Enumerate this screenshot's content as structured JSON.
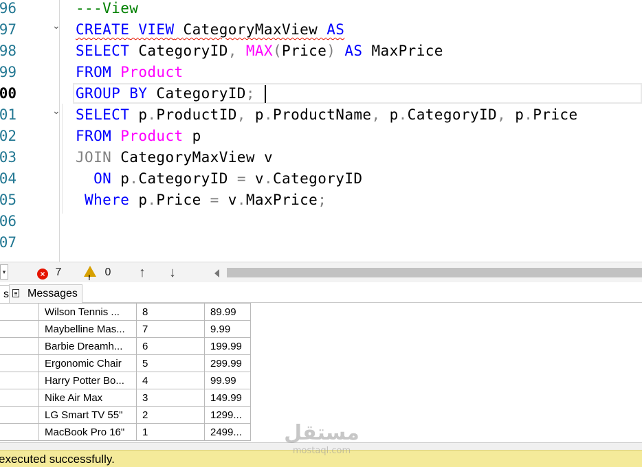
{
  "editor": {
    "line_numbers": [
      "96",
      "97",
      "98",
      "99",
      "00",
      "01",
      "02",
      "03",
      "04",
      "05",
      "06",
      "07"
    ],
    "current_line": "00",
    "lines": [
      [
        [
          "cm",
          "---View"
        ]
      ],
      [
        [
          "kw sq",
          "CREATE"
        ],
        [
          "sp sq",
          " "
        ],
        [
          "kw sq",
          "VIEW"
        ],
        [
          "sp sq",
          " "
        ],
        [
          "id sq",
          "CategoryMaxView"
        ],
        [
          "sp sq",
          " "
        ],
        [
          "kw sq",
          "AS"
        ]
      ],
      [
        [
          "kw",
          "SELECT"
        ],
        [
          "sp",
          " "
        ],
        [
          "id",
          "CategoryID"
        ],
        [
          "pu",
          ","
        ],
        [
          "sp",
          " "
        ],
        [
          "fn",
          "MAX"
        ],
        [
          "pu",
          "("
        ],
        [
          "id",
          "Price"
        ],
        [
          "pu",
          ")"
        ],
        [
          "sp",
          " "
        ],
        [
          "kw",
          "AS"
        ],
        [
          "sp",
          " "
        ],
        [
          "id",
          "MaxPrice"
        ]
      ],
      [
        [
          "kw",
          "FROM"
        ],
        [
          "sp",
          " "
        ],
        [
          "fn",
          "Product"
        ]
      ],
      [
        [
          "kw",
          "GROUP"
        ],
        [
          "sp",
          " "
        ],
        [
          "kw",
          "BY"
        ],
        [
          "sp",
          " "
        ],
        [
          "id",
          "CategoryID"
        ],
        [
          "pu",
          ";"
        ]
      ],
      [
        [
          "kw",
          "SELECT"
        ],
        [
          "sp",
          " "
        ],
        [
          "id",
          "p"
        ],
        [
          "pu",
          "."
        ],
        [
          "id",
          "ProductID"
        ],
        [
          "pu",
          ","
        ],
        [
          "sp",
          " "
        ],
        [
          "id",
          "p"
        ],
        [
          "pu",
          "."
        ],
        [
          "id",
          "ProductName"
        ],
        [
          "pu",
          ","
        ],
        [
          "sp",
          " "
        ],
        [
          "id",
          "p"
        ],
        [
          "pu",
          "."
        ],
        [
          "id",
          "CategoryID"
        ],
        [
          "pu",
          ","
        ],
        [
          "sp",
          " "
        ],
        [
          "id",
          "p"
        ],
        [
          "pu",
          "."
        ],
        [
          "id",
          "Price"
        ]
      ],
      [
        [
          "kw",
          "FROM"
        ],
        [
          "sp",
          " "
        ],
        [
          "fn",
          "Product"
        ],
        [
          "sp",
          " "
        ],
        [
          "id",
          "p"
        ]
      ],
      [
        [
          "gr",
          "JOIN"
        ],
        [
          "sp",
          " "
        ],
        [
          "id",
          "CategoryMaxView"
        ],
        [
          "sp",
          " "
        ],
        [
          "id",
          "v"
        ]
      ],
      [
        [
          "sp",
          "  "
        ],
        [
          "kw",
          "ON"
        ],
        [
          "sp",
          " "
        ],
        [
          "id",
          "p"
        ],
        [
          "pu",
          "."
        ],
        [
          "id",
          "CategoryID"
        ],
        [
          "sp",
          " "
        ],
        [
          "pu",
          "="
        ],
        [
          "sp",
          " "
        ],
        [
          "id",
          "v"
        ],
        [
          "pu",
          "."
        ],
        [
          "id",
          "CategoryID"
        ]
      ],
      [
        [
          "sp",
          " "
        ],
        [
          "kw",
          "Where"
        ],
        [
          "sp",
          " "
        ],
        [
          "id",
          "p"
        ],
        [
          "pu",
          "."
        ],
        [
          "id",
          "Price"
        ],
        [
          "sp",
          " "
        ],
        [
          "pu",
          "="
        ],
        [
          "sp",
          " "
        ],
        [
          "id",
          "v"
        ],
        [
          "pu",
          "."
        ],
        [
          "id",
          "MaxPrice"
        ],
        [
          "pu",
          ";"
        ]
      ],
      [],
      []
    ],
    "fold_lines": [
      1,
      5
    ]
  },
  "status_strip": {
    "errors": "7",
    "warnings": "0",
    "up_arrow": "↑",
    "down_arrow": "↓"
  },
  "tabs": {
    "results_label": "s",
    "messages_label": "Messages"
  },
  "grid": {
    "rows": [
      [
        "Wilson Tennis ...",
        "8",
        "89.99"
      ],
      [
        "Maybelline Mas...",
        "7",
        "9.99"
      ],
      [
        "Barbie Dreamh...",
        "6",
        "199.99"
      ],
      [
        "Ergonomic Chair",
        "5",
        "299.99"
      ],
      [
        "Harry Potter Bo...",
        "4",
        "99.99"
      ],
      [
        "Nike Air Max",
        "3",
        "149.99"
      ],
      [
        "LG Smart TV 55\"",
        "2",
        "1299..."
      ],
      [
        "MacBook Pro 16\"",
        "1",
        "2499..."
      ]
    ]
  },
  "footer": {
    "message": "executed successfully."
  },
  "watermark": {
    "arabic": "مستقل",
    "latin": "mostaql.com"
  },
  "colors": {
    "keyword": "#0000ff",
    "comment": "#008000",
    "function": "#ff00ff",
    "gray_keyword": "#808080",
    "footer_bg": "#f4ea9a"
  }
}
